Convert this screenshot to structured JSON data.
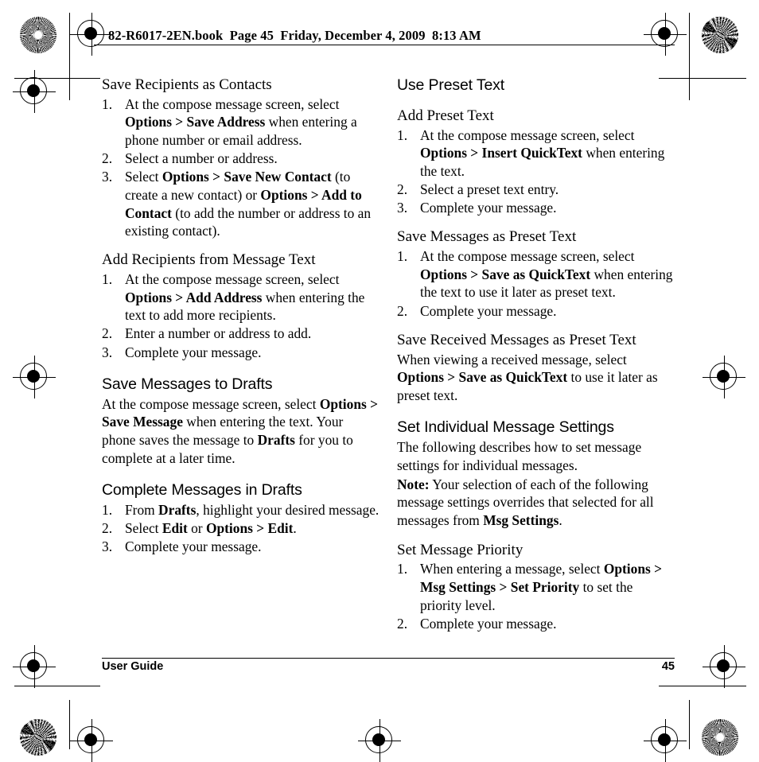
{
  "print_header": {
    "book_info": "82-R6017-2EN.book  Page 45  Friday, December 4, 2009  8:13 AM"
  },
  "footer": {
    "left_label": "User Guide",
    "page_number": "45"
  },
  "registration_marks": {
    "top_left": "starburst-rosette",
    "top_right": "moire-rosette",
    "bottom_left": "moire-rosette",
    "bottom_right": "starburst-rosette",
    "targets": "crosshair-registration-target"
  },
  "left_column": {
    "sections": [
      {
        "heading": "Save Recipients as Contacts",
        "heading_level": "h2",
        "steps": [
          {
            "num": "1.",
            "runs": [
              {
                "text": "At the compose message screen, select ",
                "bold": false
              },
              {
                "text": "Options > Save Address",
                "bold": true
              },
              {
                "text": " when entering a phone number or email address.",
                "bold": false
              }
            ]
          },
          {
            "num": "2.",
            "runs": [
              {
                "text": "Select a number or address.",
                "bold": false
              }
            ]
          },
          {
            "num": "3.",
            "runs": [
              {
                "text": "Select ",
                "bold": false
              },
              {
                "text": "Options > Save New Contact",
                "bold": true
              },
              {
                "text": " (to create a new contact) or ",
                "bold": false
              },
              {
                "text": "Options > Add to Contact",
                "bold": true
              },
              {
                "text": " (to add the number or address to an existing contact).",
                "bold": false
              }
            ]
          }
        ]
      },
      {
        "heading": "Add Recipients from Message Text",
        "heading_level": "h2",
        "steps": [
          {
            "num": "1.",
            "runs": [
              {
                "text": "At the compose message screen, select ",
                "bold": false
              },
              {
                "text": "Options > Add Address",
                "bold": true
              },
              {
                "text": " when entering the text to add more recipients.",
                "bold": false
              }
            ]
          },
          {
            "num": "2.",
            "runs": [
              {
                "text": "Enter a number or address to add.",
                "bold": false
              }
            ]
          },
          {
            "num": "3.",
            "runs": [
              {
                "text": "Complete your message.",
                "bold": false
              }
            ]
          }
        ]
      },
      {
        "heading": "Save Messages to Drafts",
        "heading_level": "h1",
        "paragraphs": [
          {
            "runs": [
              {
                "text": "At the compose message screen, select ",
                "bold": false
              },
              {
                "text": "Options > Save Message",
                "bold": true
              },
              {
                "text": " when entering the text. Your phone saves the message to ",
                "bold": false
              },
              {
                "text": "Drafts",
                "bold": true
              },
              {
                "text": " for you to complete at a later time.",
                "bold": false
              }
            ]
          }
        ]
      },
      {
        "heading": "Complete Messages in Drafts",
        "heading_level": "h1",
        "steps": [
          {
            "num": "1.",
            "runs": [
              {
                "text": "From ",
                "bold": false
              },
              {
                "text": "Drafts",
                "bold": true
              },
              {
                "text": ", highlight your desired message.",
                "bold": false
              }
            ]
          },
          {
            "num": "2.",
            "runs": [
              {
                "text": "Select ",
                "bold": false
              },
              {
                "text": "Edit",
                "bold": true
              },
              {
                "text": " or ",
                "bold": false
              },
              {
                "text": "Options > Edit",
                "bold": true
              },
              {
                "text": ".",
                "bold": false
              }
            ]
          },
          {
            "num": "3.",
            "runs": [
              {
                "text": "Complete your message.",
                "bold": false
              }
            ]
          }
        ]
      }
    ]
  },
  "right_column": {
    "sections": [
      {
        "heading": "Use Preset Text",
        "heading_level": "h1"
      },
      {
        "heading": "Add Preset Text",
        "heading_level": "h2",
        "steps": [
          {
            "num": "1.",
            "runs": [
              {
                "text": "At the compose message screen, select ",
                "bold": false
              },
              {
                "text": "Options > Insert QuickText",
                "bold": true
              },
              {
                "text": " when entering the text.",
                "bold": false
              }
            ]
          },
          {
            "num": "2.",
            "runs": [
              {
                "text": "Select a preset text entry.",
                "bold": false
              }
            ]
          },
          {
            "num": "3.",
            "runs": [
              {
                "text": "Complete your message.",
                "bold": false
              }
            ]
          }
        ]
      },
      {
        "heading": "Save Messages as Preset Text",
        "heading_level": "h2",
        "steps": [
          {
            "num": "1.",
            "runs": [
              {
                "text": "At the compose message screen, select ",
                "bold": false
              },
              {
                "text": "Options > Save as QuickText",
                "bold": true
              },
              {
                "text": " when entering the text to use it later as preset text.",
                "bold": false
              }
            ]
          },
          {
            "num": "2.",
            "runs": [
              {
                "text": "Complete your message.",
                "bold": false
              }
            ]
          }
        ]
      },
      {
        "heading": "Save Received Messages as Preset Text",
        "heading_level": "h2",
        "paragraphs": [
          {
            "runs": [
              {
                "text": "When viewing a received message, select ",
                "bold": false
              },
              {
                "text": "Options > Save as QuickText",
                "bold": true
              },
              {
                "text": " to use it later as preset text.",
                "bold": false
              }
            ]
          }
        ]
      },
      {
        "heading": "Set Individual Message Settings",
        "heading_level": "h1",
        "paragraphs": [
          {
            "runs": [
              {
                "text": "The following describes how to set message settings for individual messages.",
                "bold": false
              }
            ]
          },
          {
            "runs": [
              {
                "text": "Note:",
                "bold": true
              },
              {
                "text": " Your selection of each of the following message settings overrides that selected for all messages from ",
                "bold": false
              },
              {
                "text": "Msg Settings",
                "bold": true
              },
              {
                "text": ".",
                "bold": false
              }
            ]
          }
        ]
      },
      {
        "heading": "Set Message Priority",
        "heading_level": "h2",
        "steps": [
          {
            "num": "1.",
            "runs": [
              {
                "text": "When entering a message, select ",
                "bold": false
              },
              {
                "text": "Options > Msg Settings > Set Priority",
                "bold": true
              },
              {
                "text": " to set the priority level.",
                "bold": false
              }
            ]
          },
          {
            "num": "2.",
            "runs": [
              {
                "text": "Complete your message.",
                "bold": false
              }
            ]
          }
        ]
      }
    ]
  }
}
